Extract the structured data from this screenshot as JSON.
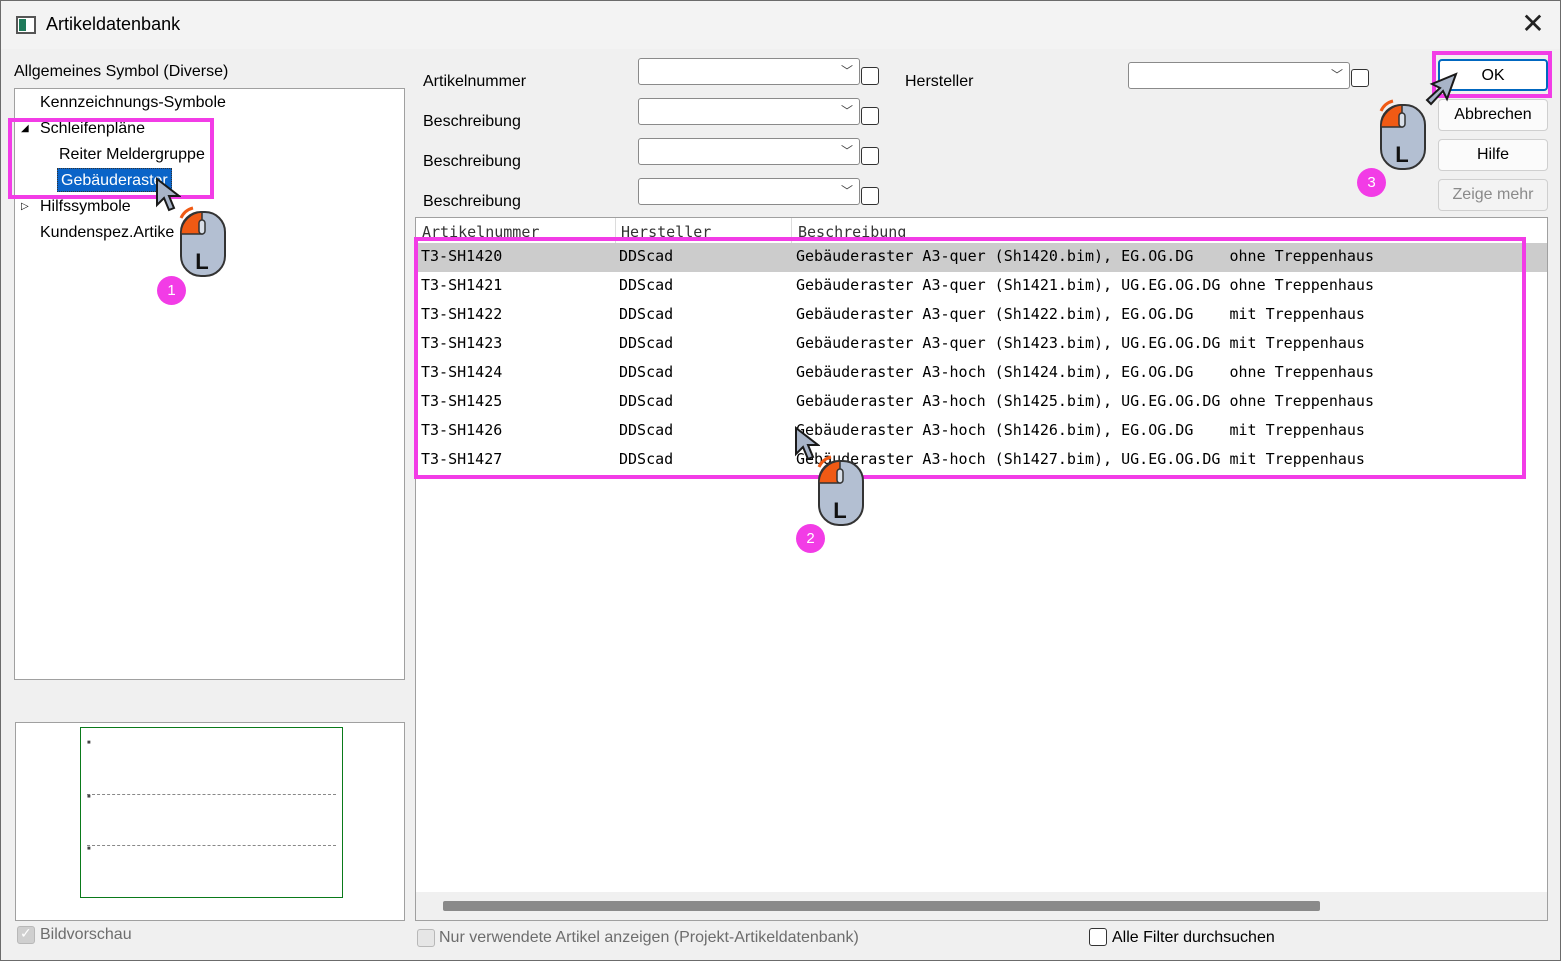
{
  "window": {
    "title": "Artikeldatenbank",
    "close_glyph": "✕"
  },
  "left": {
    "group_label": "Allgemeines Symbol (Diverse)",
    "tree": {
      "kennzeichnung": "Kennzeichnungs-Symbole",
      "schleifenplaene": "Schleifenpläne",
      "reiter": "Reiter Meldergruppe",
      "gebaeuderaster": "Gebäuderaster",
      "hilfssymbole": "Hilfssymbole",
      "kundenspez": "Kundenspez.Artikel"
    },
    "bildvorschau": "Bildvorschau"
  },
  "filters": {
    "artikelnummer": "Artikelnummer",
    "beschreibung1": "Beschreibung",
    "beschreibung2": "Beschreibung",
    "beschreibung3": "Beschreibung",
    "hersteller": "Hersteller"
  },
  "buttons": {
    "ok": "OK",
    "abbrechen": "Abbrechen",
    "hilfe": "Hilfe",
    "zeige_mehr": "Zeige mehr"
  },
  "table": {
    "headers": [
      "Artikelnummer",
      "Hersteller",
      "Beschreibung"
    ],
    "rows": [
      [
        "T3-SH1420",
        "DDScad",
        "Gebäuderaster A3-quer (Sh1420.bim), EG.OG.DG    ohne Treppenhaus"
      ],
      [
        "T3-SH1421",
        "DDScad",
        "Gebäuderaster A3-quer (Sh1421.bim), UG.EG.OG.DG ohne Treppenhaus"
      ],
      [
        "T3-SH1422",
        "DDScad",
        "Gebäuderaster A3-quer (Sh1422.bim), EG.OG.DG    mit Treppenhaus"
      ],
      [
        "T3-SH1423",
        "DDScad",
        "Gebäuderaster A3-quer (Sh1423.bim), UG.EG.OG.DG mit Treppenhaus"
      ],
      [
        "T3-SH1424",
        "DDScad",
        "Gebäuderaster A3-hoch (Sh1424.bim), EG.OG.DG    ohne Treppenhaus"
      ],
      [
        "T3-SH1425",
        "DDScad",
        "Gebäuderaster A3-hoch (Sh1425.bim), UG.EG.OG.DG ohne Treppenhaus"
      ],
      [
        "T3-SH1426",
        "DDScad",
        "Gebäuderaster A3-hoch (Sh1426.bim), EG.OG.DG    mit Treppenhaus"
      ],
      [
        "T3-SH1427",
        "DDScad",
        "Gebäuderaster A3-hoch (Sh1427.bim), UG.EG.OG.DG mit Treppenhaus"
      ]
    ]
  },
  "bottom": {
    "nur_verwendete": "Nur verwendete Artikel anzeigen (Projekt-Artikeldatenbank)",
    "alle_filter": "Alle Filter durchsuchen"
  },
  "annotations": {
    "step1": "1",
    "step2": "2",
    "step3": "3",
    "mouse_letter": "L",
    "highlight_color": "#f23ce6"
  }
}
